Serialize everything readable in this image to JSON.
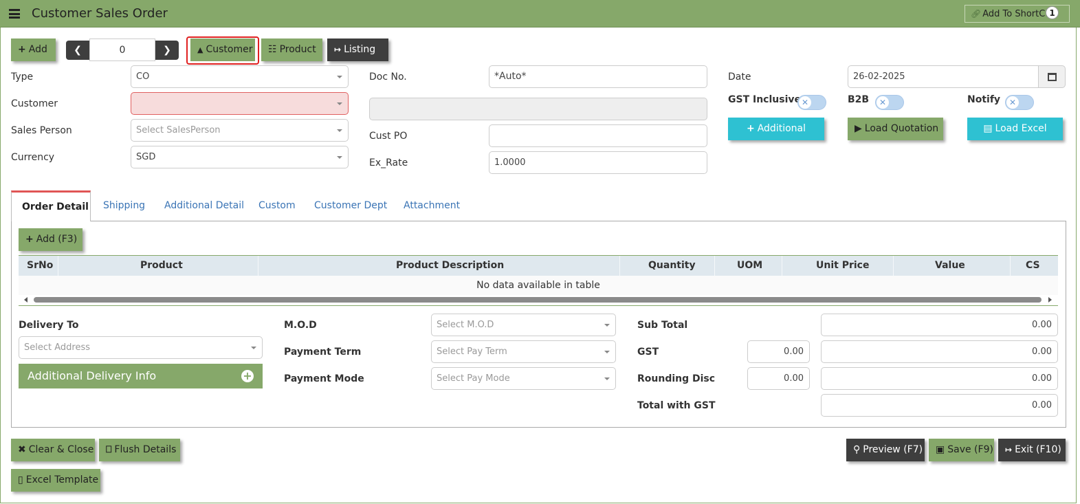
{
  "header": {
    "title": "Customer Sales Order",
    "shortcut_label": "Add To ShortCut",
    "shortcut_count": "1"
  },
  "toolbar": {
    "add_label": "Add",
    "pager_value": "0",
    "customer_label": "Customer",
    "product_label": "Product",
    "listing_label": "Listing"
  },
  "form": {
    "type_label": "Type",
    "type_value": "CO",
    "customer_label": "Customer",
    "sales_person_label": "Sales Person",
    "sales_person_placeholder": "Select SalesPerson",
    "currency_label": "Currency",
    "currency_value": "SGD",
    "doc_no_label": "Doc No.",
    "doc_no_value": "*Auto*",
    "cust_po_label": "Cust PO",
    "ex_rate_label": "Ex_Rate",
    "ex_rate_value": "1.0000",
    "date_label": "Date",
    "date_value": "26-02-2025",
    "gst_inclusive_label": "GST Inclusive",
    "b2b_label": "B2B",
    "notify_label": "Notify",
    "additional_label": "Additional",
    "load_quotation_label": "Load Quotation",
    "load_excel_label": "Load Excel"
  },
  "tabs": [
    "Order Detail",
    "Shipping",
    "Additional Detail",
    "Custom",
    "Customer Dept",
    "Attachment"
  ],
  "detail": {
    "add_label": "Add (F3)",
    "columns": [
      "SrNo",
      "Product",
      "Product Description",
      "Quantity",
      "UOM",
      "Unit Price",
      "Value",
      "CS"
    ],
    "empty_text": "No data available in table"
  },
  "delivery": {
    "delivery_to_label": "Delivery To",
    "address_placeholder": "Select Address",
    "additional_info_label": "Additional Delivery Info",
    "mod_label": "M.O.D",
    "mod_placeholder": "Select M.O.D",
    "payment_term_label": "Payment Term",
    "payment_term_placeholder": "Select Pay Term",
    "payment_mode_label": "Payment Mode",
    "payment_mode_placeholder": "Select Pay Mode"
  },
  "totals": {
    "sub_total_label": "Sub Total",
    "sub_total_value": "0.00",
    "gst_label": "GST",
    "gst_rate": "0.00",
    "gst_value": "0.00",
    "rounding_label": "Rounding Disc",
    "rounding_rate": "0.00",
    "rounding_value": "0.00",
    "total_label": "Total with GST",
    "total_value": "0.00"
  },
  "footer": {
    "clear_close_label": "Clear & Close",
    "flush_label": "Flush Details",
    "excel_template_label": "Excel Template",
    "preview_label": "Preview (F7)",
    "save_label": "Save (F9)",
    "exit_label": "Exit (F10)"
  },
  "colors": {
    "accent_green": "#86a86a",
    "dark": "#3e3e3e",
    "cyan": "#2ec1d2",
    "error_bg": "#f7dcdc",
    "highlight": "#e02020"
  },
  "icons": [
    "menu-icon",
    "link-icon",
    "plus-icon",
    "chevron-left-icon",
    "chevron-right-icon",
    "user-icon",
    "gift-icon",
    "sign-out-icon",
    "calendar-icon",
    "play-circle-icon",
    "file-excel-icon",
    "times-icon",
    "trash-icon",
    "file-icon",
    "search-icon",
    "floppy-icon",
    "plus-circle-icon"
  ]
}
